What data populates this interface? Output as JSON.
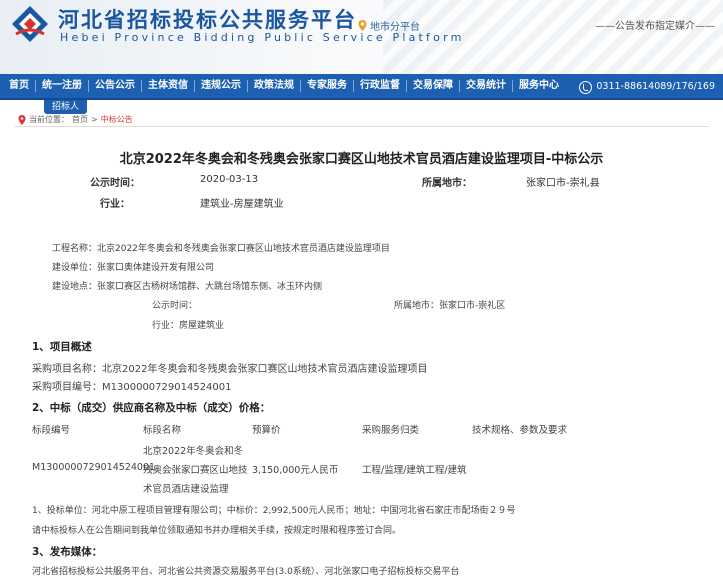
{
  "header": {
    "title": "河北省招标投标公共服务平台",
    "subtitle": "Hebei Province Bidding Public Service Platform",
    "region_link": "地市分平台",
    "media_text": "——公告发布指定媒介——"
  },
  "nav": {
    "items": [
      "首页",
      "统一注册",
      "公告公示",
      "主体资信",
      "违规公示",
      "政策法规",
      "专家服务",
      "行政监督",
      "交易保障",
      "交易统计",
      "服务中心"
    ],
    "phone": "0311-88614089/176/169",
    "subtab": "招标人"
  },
  "breadcrumb": {
    "prefix": "当前位置：",
    "home": "首页",
    "sep": ">",
    "current": "中标公告"
  },
  "notice": {
    "title": "北京2022年冬奥会和冬残奥会张家口赛区山地技术官员酒店建设监理项目-中标公示",
    "publish_label": "公示时间：",
    "publish_value": "2020-03-13",
    "location_label": "所属地市：",
    "location_value": "张家口市-崇礼县",
    "industry_label": "行业：",
    "industry_value": "建筑业-房屋建筑业"
  },
  "body": {
    "project_name": "工程名称：北京2022年冬奥会和冬残奥会张家口赛区山地技术官员酒店建设监理项目",
    "builder": "建设单位：张家口奥体建设开发有限公司",
    "site": "建设地点：张家口赛区古杨树场馆群、大跳台场馆东侧、冰玉环内侧",
    "pub_time": "公示时间：",
    "pub_city": "所属地市：张家口市-崇礼区",
    "pub_industry": "行业：房屋建筑业",
    "sec1_title": "1、项目概述",
    "purchase_name": "采购项目名称：北京2022年冬奥会和冬残奥会张家口赛区山地技术官员酒店建设监理项目",
    "purchase_no": "采购项目编号：M1300000729014524001",
    "sec2_title": "2、中标（成交）供应商名称及中标（成交）价格：",
    "table": {
      "headers": [
        "标段编号",
        "标段名称",
        "预算价",
        "采购服务归类",
        "技术规格、参数及要求"
      ],
      "code": "M1300000729014524001",
      "name_lines": [
        "北京2022年冬奥会和冬",
        "残奥会张家口赛区山地技",
        "术官员酒店建设监理"
      ],
      "budget": "3,150,000元人民币",
      "category": "工程/监理/建筑工程/建筑"
    },
    "winner_line": "1、投标单位：河北中原工程项目管理有限公司；中标价：2,992,500元人民币；地址：中国河北省石家庄市配场街２９号",
    "notice_line": "请中标投标人在公告期间到我单位领取通知书并办理相关手续，按规定时限和程序签订合同。",
    "sec3_title": "3、发布媒体：",
    "media_line": "河北省招标投标公共服务平台、河北省公共资源交易服务平台(3.0系统）、河北张家口电子招标投标交易平台"
  },
  "colors": {
    "brand_blue": "#1d5fb0",
    "title_blue": "#1a57a0",
    "accent_red": "#d33"
  }
}
